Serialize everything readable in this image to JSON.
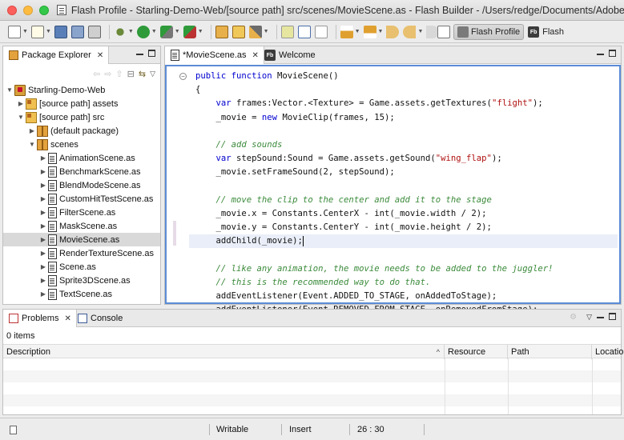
{
  "window": {
    "title": "Flash Profile - Starling-Demo-Web/[source path] src/scenes/MovieScene.as - Flash Builder - /Users/redge/Documents/Adobe Fla..."
  },
  "toolbar": {
    "perspectives": [
      {
        "label": "Flash Profile",
        "active": true
      },
      {
        "label": "Flash",
        "active": false
      }
    ]
  },
  "package_explorer": {
    "tab_label": "Package Explorer",
    "tree": [
      {
        "label": "Starling-Demo-Web",
        "depth": 0,
        "expanded": true,
        "icon": "project-icon"
      },
      {
        "label": "[source path] assets",
        "depth": 1,
        "expanded": false,
        "icon": "source-folder-icon"
      },
      {
        "label": "[source path] src",
        "depth": 1,
        "expanded": true,
        "icon": "source-folder-icon"
      },
      {
        "label": "(default package)",
        "depth": 2,
        "expanded": false,
        "icon": "package-icon"
      },
      {
        "label": "scenes",
        "depth": 2,
        "expanded": true,
        "icon": "package-icon"
      },
      {
        "label": "AnimationScene.as",
        "depth": 3,
        "expanded": false,
        "icon": "as-file-icon"
      },
      {
        "label": "BenchmarkScene.as",
        "depth": 3,
        "expanded": false,
        "icon": "as-file-icon"
      },
      {
        "label": "BlendModeScene.as",
        "depth": 3,
        "expanded": false,
        "icon": "as-file-icon"
      },
      {
        "label": "CustomHitTestScene.as",
        "depth": 3,
        "expanded": false,
        "icon": "as-file-icon"
      },
      {
        "label": "FilterScene.as",
        "depth": 3,
        "expanded": false,
        "icon": "as-file-icon"
      },
      {
        "label": "MaskScene.as",
        "depth": 3,
        "expanded": false,
        "icon": "as-file-icon"
      },
      {
        "label": "MovieScene.as",
        "depth": 3,
        "expanded": false,
        "icon": "as-file-icon",
        "selected": true
      },
      {
        "label": "RenderTextureScene.as",
        "depth": 3,
        "expanded": false,
        "icon": "as-file-icon"
      },
      {
        "label": "Scene.as",
        "depth": 3,
        "expanded": false,
        "icon": "as-file-icon"
      },
      {
        "label": "Sprite3DScene.as",
        "depth": 3,
        "expanded": false,
        "icon": "as-file-icon"
      },
      {
        "label": "TextScene.as",
        "depth": 3,
        "expanded": false,
        "icon": "as-file-icon"
      }
    ]
  },
  "editor": {
    "tabs": [
      {
        "label": "*MovieScene.as",
        "active": true
      },
      {
        "label": "Welcome",
        "active": false
      }
    ],
    "code": [
      {
        "segments": [
          {
            "t": "public function",
            "c": "kw"
          },
          {
            "t": " MovieScene()",
            "c": ""
          }
        ]
      },
      {
        "segments": [
          {
            "t": "{",
            "c": ""
          }
        ]
      },
      {
        "segments": [
          {
            "t": "    ",
            "c": ""
          },
          {
            "t": "var",
            "c": "kw"
          },
          {
            "t": " frames:Vector.<Texture> = Game.assets.getTextures(",
            "c": ""
          },
          {
            "t": "\"flight\"",
            "c": "st"
          },
          {
            "t": ");",
            "c": ""
          }
        ]
      },
      {
        "segments": [
          {
            "t": "    _movie = ",
            "c": ""
          },
          {
            "t": "new",
            "c": "kw"
          },
          {
            "t": " MovieClip(frames, 15);",
            "c": ""
          }
        ]
      },
      {
        "segments": []
      },
      {
        "segments": [
          {
            "t": "    // add sounds",
            "c": "cm"
          }
        ]
      },
      {
        "segments": [
          {
            "t": "    ",
            "c": ""
          },
          {
            "t": "var",
            "c": "kw"
          },
          {
            "t": " stepSound:Sound = Game.assets.getSound(",
            "c": ""
          },
          {
            "t": "\"wing_flap\"",
            "c": "st"
          },
          {
            "t": ");",
            "c": ""
          }
        ]
      },
      {
        "segments": [
          {
            "t": "    _movie.setFrameSound(2, stepSound);",
            "c": ""
          }
        ]
      },
      {
        "segments": []
      },
      {
        "segments": [
          {
            "t": "    // move the clip to the center and add it to the stage",
            "c": "cm"
          }
        ]
      },
      {
        "segments": [
          {
            "t": "    _movie.x = Constants.CenterX - int(_movie.width / 2);",
            "c": ""
          }
        ]
      },
      {
        "segments": [
          {
            "t": "    _movie.y = Constants.CenterY - int(_movie.height / 2);",
            "c": ""
          }
        ]
      },
      {
        "segments": [
          {
            "t": "    addChild(_movie);",
            "c": ""
          }
        ],
        "current": true
      },
      {
        "segments": []
      },
      {
        "segments": [
          {
            "t": "    // like any animation, the movie needs to be added to the juggler!",
            "c": "cm"
          }
        ]
      },
      {
        "segments": [
          {
            "t": "    // this is the recommended way to do that.",
            "c": "cm"
          }
        ]
      },
      {
        "segments": [
          {
            "t": "    addEventListener(Event.ADDED_TO_STAGE, onAddedToStage);",
            "c": ""
          }
        ]
      },
      {
        "segments": [
          {
            "t": "    addEventListener(Event.REMOVED_FROM_STAGE, onRemovedFromStage);",
            "c": ""
          }
        ]
      },
      {
        "segments": [
          {
            "t": "}",
            "c": ""
          }
        ]
      }
    ]
  },
  "bottom_panel": {
    "tabs": [
      {
        "label": "Problems",
        "active": true
      },
      {
        "label": "Console",
        "active": false
      }
    ],
    "item_count": "0 items",
    "columns": [
      {
        "label": "Description",
        "sort": "^"
      },
      {
        "label": "Resource"
      },
      {
        "label": "Path"
      },
      {
        "label": "Locatio"
      }
    ]
  },
  "status_bar": {
    "writable": "Writable",
    "insert_mode": "Insert",
    "cursor_position": "26 : 30"
  }
}
